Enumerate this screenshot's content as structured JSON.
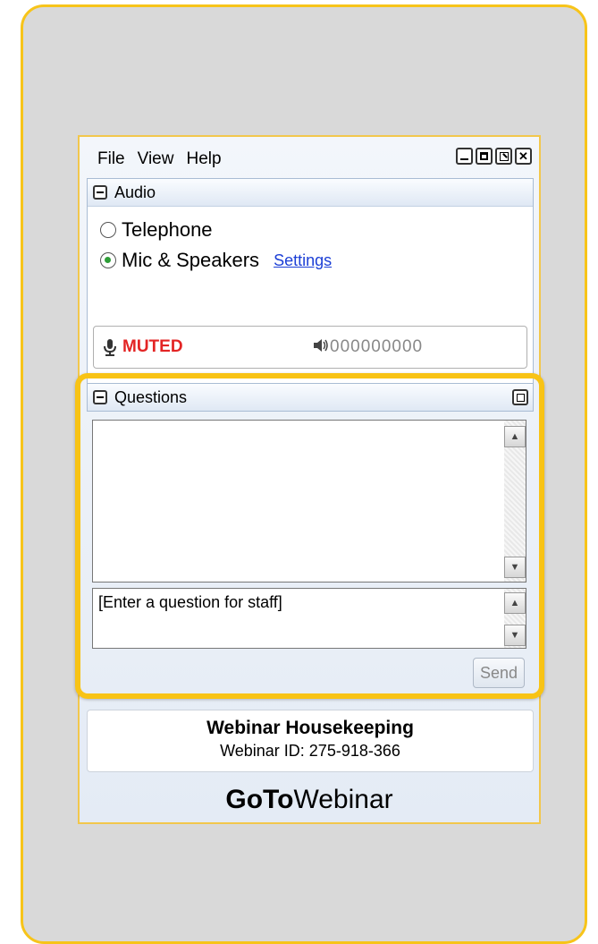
{
  "menu": [
    "File",
    "View",
    "Help"
  ],
  "window_controls": [
    "minimize-icon",
    "maximize-icon",
    "popout-icon",
    "close-icon"
  ],
  "audio": {
    "title": "Audio",
    "options": [
      {
        "label": "Telephone",
        "selected": false
      },
      {
        "label": "Mic & Speakers",
        "selected": true
      }
    ],
    "settings_link": "Settings",
    "status": "MUTED",
    "levels": "000000000"
  },
  "questions": {
    "title": "Questions",
    "input_placeholder": "[Enter a question for staff]",
    "send_label": "Send"
  },
  "footer": {
    "title": "Webinar Housekeeping",
    "webinar_id": "Webinar ID: 275-918-366"
  },
  "brand": {
    "bold": "GoTo",
    "normal": "Webinar"
  },
  "colors": {
    "accent_border": "#f8c315",
    "muted_red": "#e32424",
    "link_blue": "#1c3fd6",
    "radio_green": "#2e9d38"
  }
}
